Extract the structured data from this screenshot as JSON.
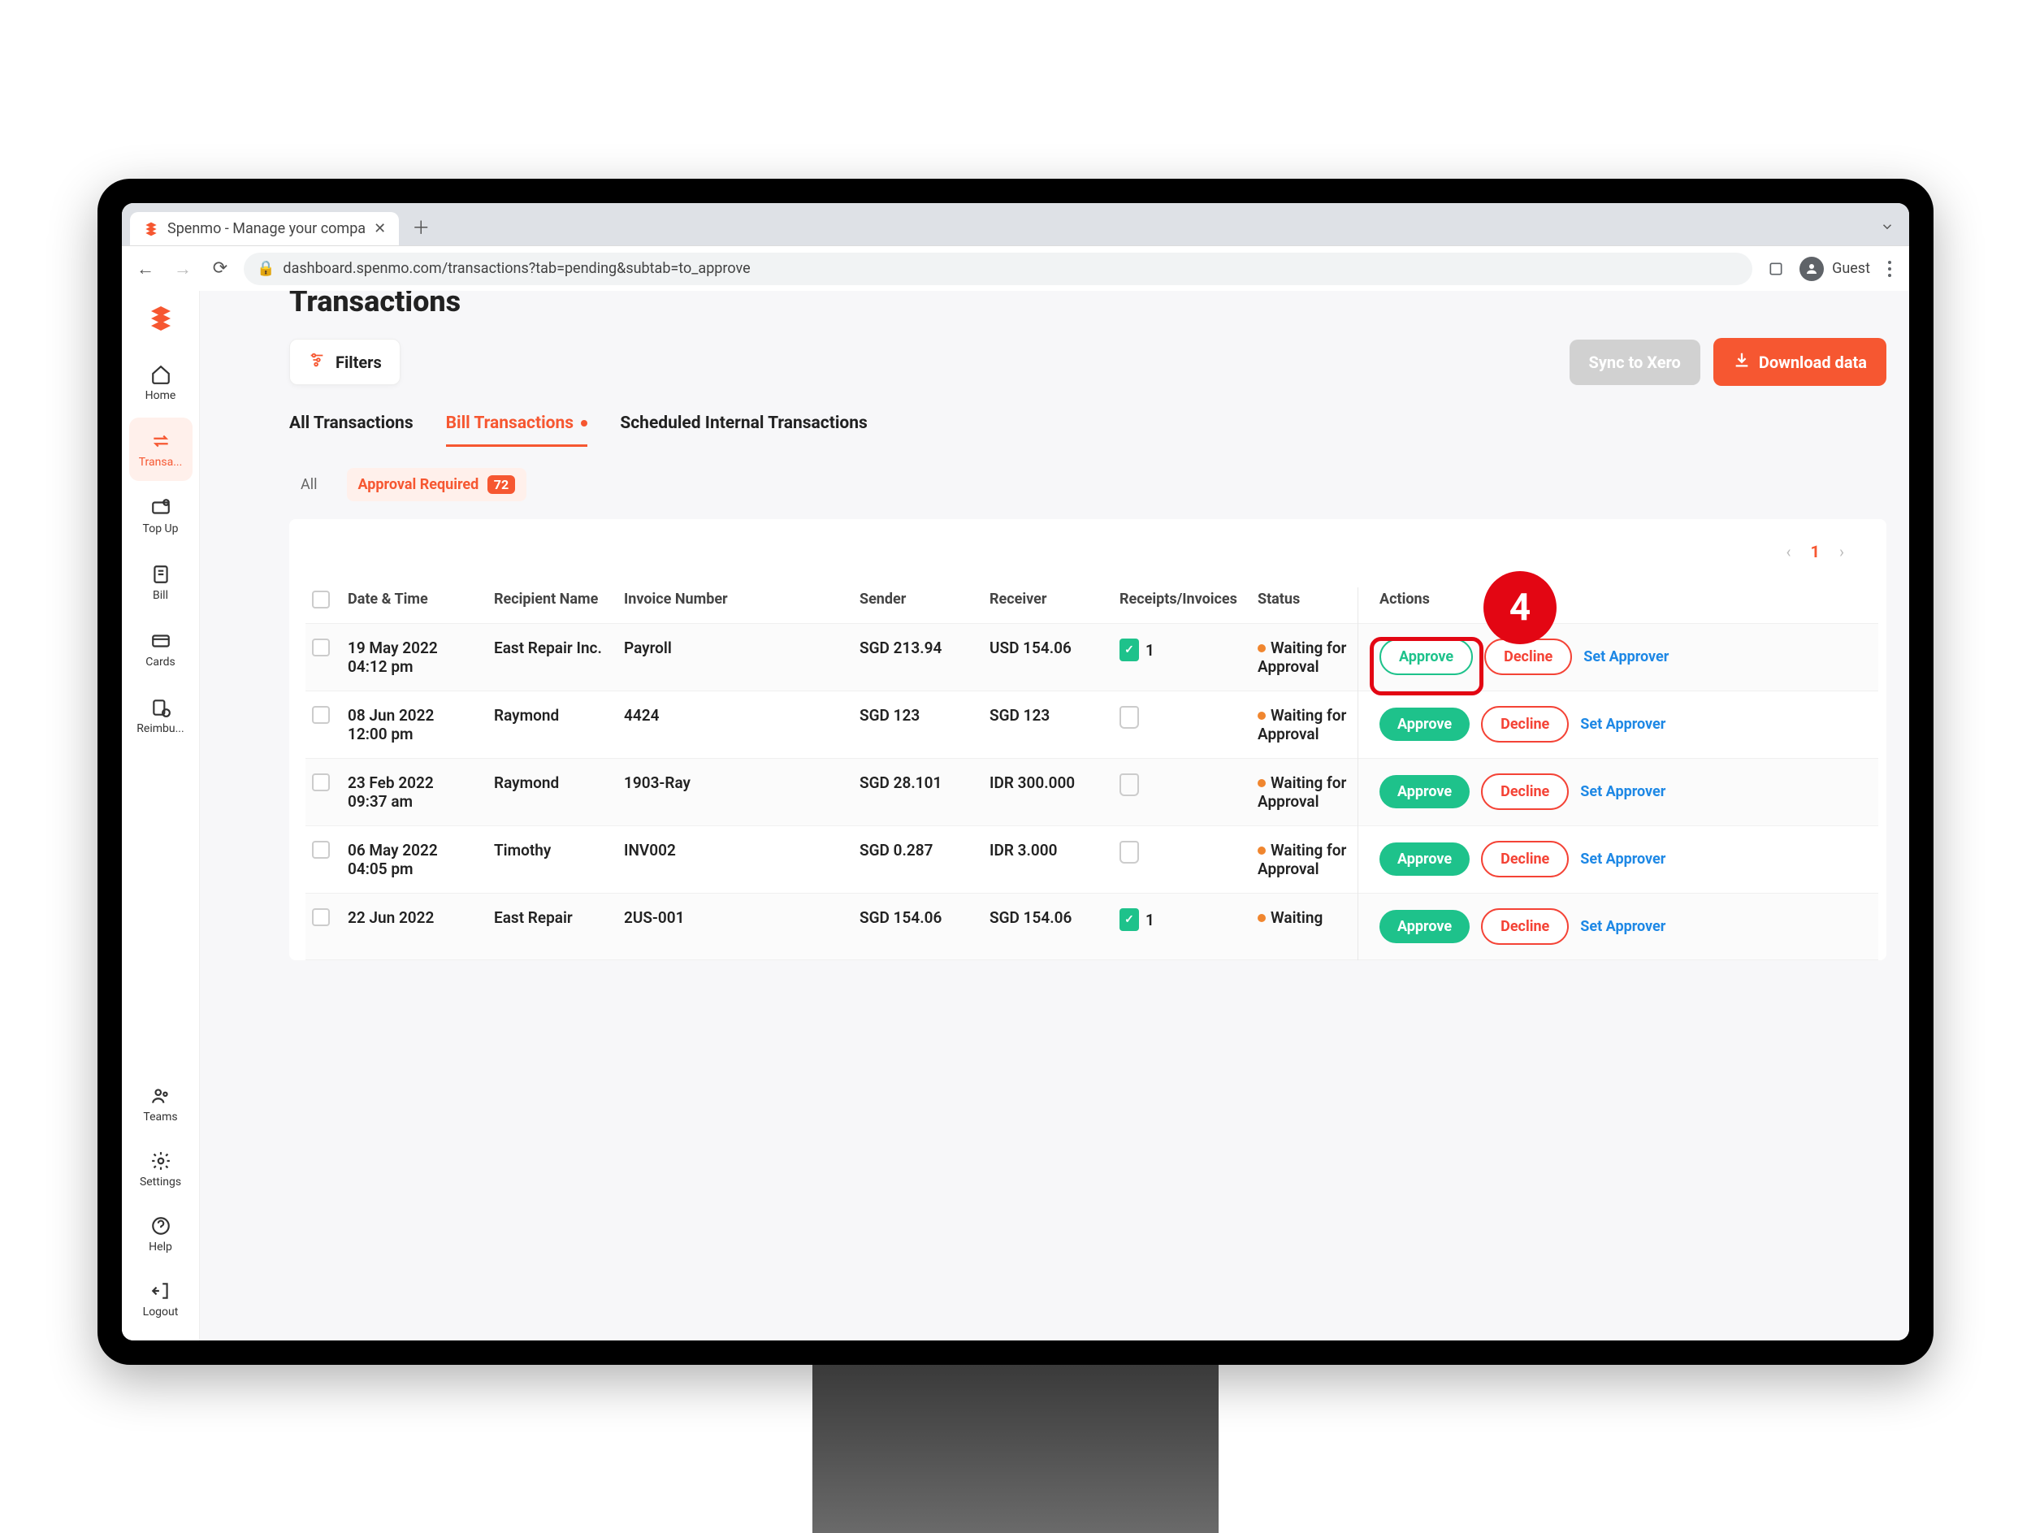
{
  "browser": {
    "tab_title": "Spenmo - Manage your compa",
    "url": "dashboard.spenmo.com/transactions?tab=pending&subtab=to_approve",
    "profile_label": "Guest"
  },
  "sidebar": {
    "items": [
      {
        "label": "Home"
      },
      {
        "label": "Transa..."
      },
      {
        "label": "Top Up"
      },
      {
        "label": "Bill"
      },
      {
        "label": "Cards"
      },
      {
        "label": "Reimbu..."
      }
    ],
    "bottom": [
      {
        "label": "Teams"
      },
      {
        "label": "Settings"
      },
      {
        "label": "Help"
      },
      {
        "label": "Logout"
      }
    ]
  },
  "page": {
    "title": "Transactions",
    "filters_label": "Filters",
    "sync_label": "Sync to Xero",
    "download_label": "Download data"
  },
  "tabs": {
    "items": [
      "All Transactions",
      "Bill Transactions",
      "Scheduled Internal Transactions"
    ]
  },
  "subtabs": {
    "all": "All",
    "approval_label": "Approval Required",
    "approval_count": "72"
  },
  "pagination": {
    "current": "1"
  },
  "columns": {
    "date": "Date & Time",
    "recipient": "Recipient Name",
    "invoice": "Invoice Number",
    "sender": "Sender",
    "receiver": "Receiver",
    "receipts": "Receipts/Invoices",
    "status": "Status",
    "actions": "Actions"
  },
  "action_labels": {
    "approve": "Approve",
    "decline": "Decline",
    "set_approver": "Set Approver"
  },
  "rows": [
    {
      "date": "19 May 2022",
      "time": "04:12 pm",
      "recipient": "East Repair Inc.",
      "invoice": "Payroll",
      "sender": "SGD 213.94",
      "receiver": "USD 154.06",
      "receipt_count": "1",
      "has_receipt": true,
      "status": "Waiting for Approval",
      "approve_outline": true
    },
    {
      "date": "08 Jun 2022",
      "time": "12:00 pm",
      "recipient": "Raymond",
      "invoice": "4424",
      "sender": "SGD 123",
      "receiver": "SGD 123",
      "receipt_count": "",
      "has_receipt": false,
      "status": "Waiting for Approval",
      "approve_outline": false
    },
    {
      "date": "23 Feb 2022",
      "time": "09:37 am",
      "recipient": "Raymond",
      "invoice": "1903-Ray",
      "sender": "SGD 28.101",
      "receiver": "IDR 300.000",
      "receipt_count": "",
      "has_receipt": false,
      "status": "Waiting for Approval",
      "approve_outline": false
    },
    {
      "date": "06 May 2022",
      "time": "04:05 pm",
      "recipient": "Timothy",
      "invoice": "INV002",
      "sender": "SGD 0.287",
      "receiver": "IDR 3.000",
      "receipt_count": "",
      "has_receipt": false,
      "status": "Waiting for Approval",
      "approve_outline": false
    },
    {
      "date": "22 Jun 2022",
      "time": "",
      "recipient": "East Repair",
      "invoice": "2US-001",
      "sender": "SGD 154.06",
      "receiver": "SGD 154.06",
      "receipt_count": "1",
      "has_receipt": true,
      "status": "Waiting",
      "approve_outline": false
    }
  ],
  "annotation": {
    "number": "4"
  }
}
